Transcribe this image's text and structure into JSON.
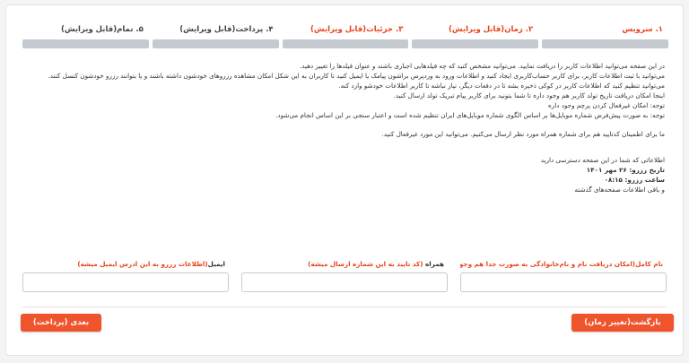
{
  "steps": [
    {
      "label": "۱. سرویس",
      "active": true
    },
    {
      "label": "۲. زمان(قابل ویرایش)",
      "active": true
    },
    {
      "label": "۳. جزئیات(قابل ویرایش)",
      "active": true
    },
    {
      "label": "۴. پرداخت(قابل ویرایش)",
      "active": false
    },
    {
      "label": "۵. تمام(قابل ویرایش)",
      "active": false
    }
  ],
  "info": {
    "lines": [
      "در این صفحه می‌توانید اطلاعات کاربر را دریافت نمایید. می‌توانید مشخص کنید که چه فیلدهایی اجباری باشند و عنوان فیلدها را تغییر دهید.",
      "می‌توانید با ثبت اطلاعات کاربر، برای کاربر حساب‌کاربری ایجاد کنید و اطلاعات ورود به وردپرس براشون پیامک یا ایمیل کنید تا کاربران به این شکل امکان مشاهده رزروهای خودشون داشته باشند و یا بتوانند رزرو خودشون کنسل کنند.",
      "می‌توانید تنظیم کنید که اطلاعات کاربر در کوکی ذخیره بشه تا در دفعات دیگر، نیاز نباشه تا کاربر اطلاعات خودشو وارد کنه.",
      "اینجا امکان دریافت تاریخ تولد کاربر هم وجود داره تا شما بتونید برای کاربر پیام تبریک تولد ارسال کنید.",
      "توجه: امکان غیرفعال کردن پرچم وجود داره",
      "توجه: به صورت پیش‌فرض شماره موبایل‌ها بر اساس الگوی شماره موبایل‌های ایران تنظیم شده است و اعتبار سنجی بر این اساس انجام می‌شود."
    ],
    "verify_line": "ما برای اطمینان کدتایید هم برای شماره همراه مورد نظر ارسال می‌کنیم. می‌توانید این مورد غیرفعال کنید."
  },
  "reserve": {
    "intro": "اطلاعاتی که شما در این صفحه دسترسی دارید",
    "date": "تاریخ رزرو: ۲۶ مهر ۱۴۰۱",
    "time": "ساعت رزرو: ۰۸:۱۵",
    "other": "و باقی اطلاعات صفحه‌های گذشته"
  },
  "fields": {
    "name_label": "نام کامل(امکان دریافت نام و نام‌خانوادگی به صورت جدا هم وجود داره)",
    "mobile_label_dark": "همراه",
    "mobile_label_note": "(کد تایید به این شماره ارسال میشه)",
    "email_label_dark": "ایمیل",
    "email_label_note": "(اطلاعات رزرو به این ادرس ایمیل میشه)"
  },
  "buttons": {
    "back": "بازگشت(تغییر زمان)",
    "next": "بعدی (پرداخت)"
  },
  "colors": {
    "accent": "#f0542d",
    "step_active": "#e8431c",
    "bar": "#c5c9d0"
  }
}
